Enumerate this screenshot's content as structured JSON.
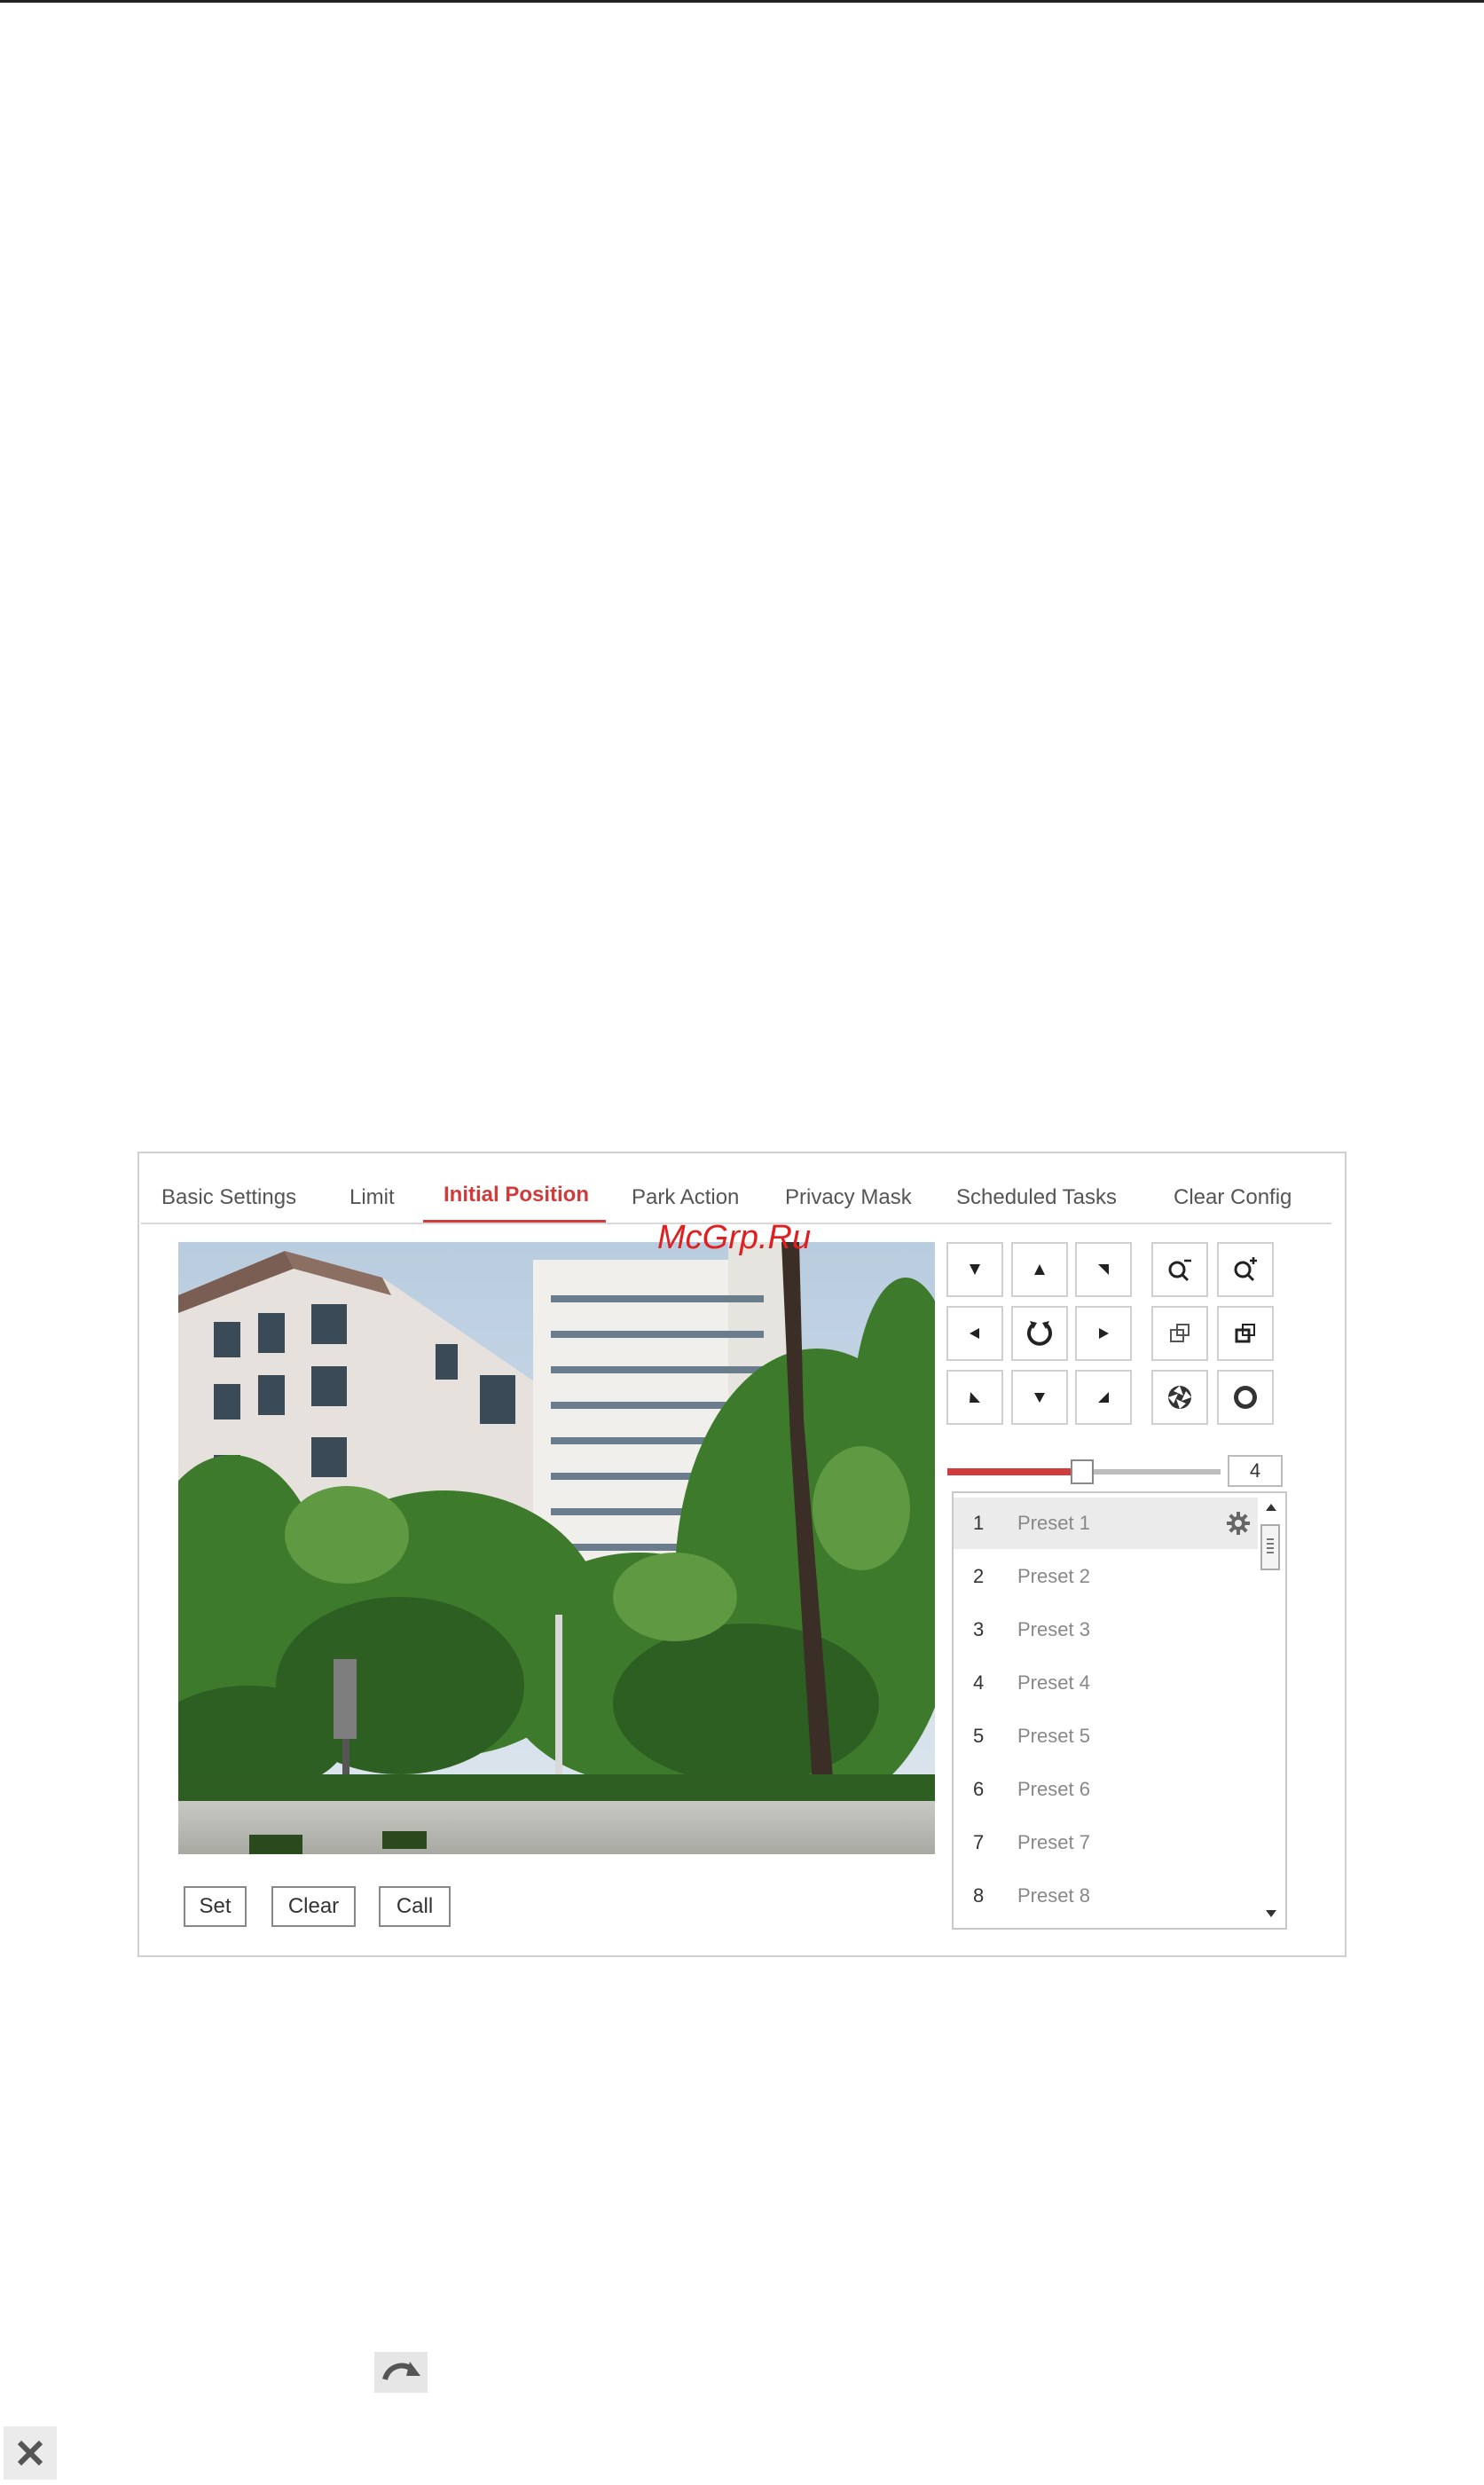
{
  "tabs": [
    {
      "label": "Basic Settings"
    },
    {
      "label": "Limit"
    },
    {
      "label": "Initial Position"
    },
    {
      "label": "Park Action"
    },
    {
      "label": "Privacy Mask"
    },
    {
      "label": "Scheduled Tasks"
    },
    {
      "label": "Clear Config"
    }
  ],
  "active_tab": "Initial Position",
  "watermark": "McGrp.Ru",
  "buttons": {
    "set": "Set",
    "clear": "Clear",
    "call": "Call"
  },
  "ptz": {
    "speed_value": "4",
    "speed_fraction": 0.5,
    "icons": [
      "up-left-arrow-icon",
      "up-arrow-icon",
      "up-right-arrow-icon",
      "left-arrow-icon",
      "auto-scan-icon",
      "right-arrow-icon",
      "down-left-arrow-icon",
      "down-arrow-icon",
      "down-right-arrow-icon",
      "zoom-out-icon",
      "zoom-in-icon",
      "focus-near-icon",
      "focus-far-icon",
      "iris-close-icon",
      "iris-open-icon"
    ]
  },
  "presets": [
    {
      "num": "1",
      "name": "Preset 1"
    },
    {
      "num": "2",
      "name": "Preset 2"
    },
    {
      "num": "3",
      "name": "Preset 3"
    },
    {
      "num": "4",
      "name": "Preset 4"
    },
    {
      "num": "5",
      "name": "Preset 5"
    },
    {
      "num": "6",
      "name": "Preset 6"
    },
    {
      "num": "7",
      "name": "Preset 7"
    },
    {
      "num": "8",
      "name": "Preset 8"
    }
  ],
  "colors": {
    "accent": "#d23b3b",
    "border": "#d0d0d0",
    "preset_text": "#888888"
  }
}
